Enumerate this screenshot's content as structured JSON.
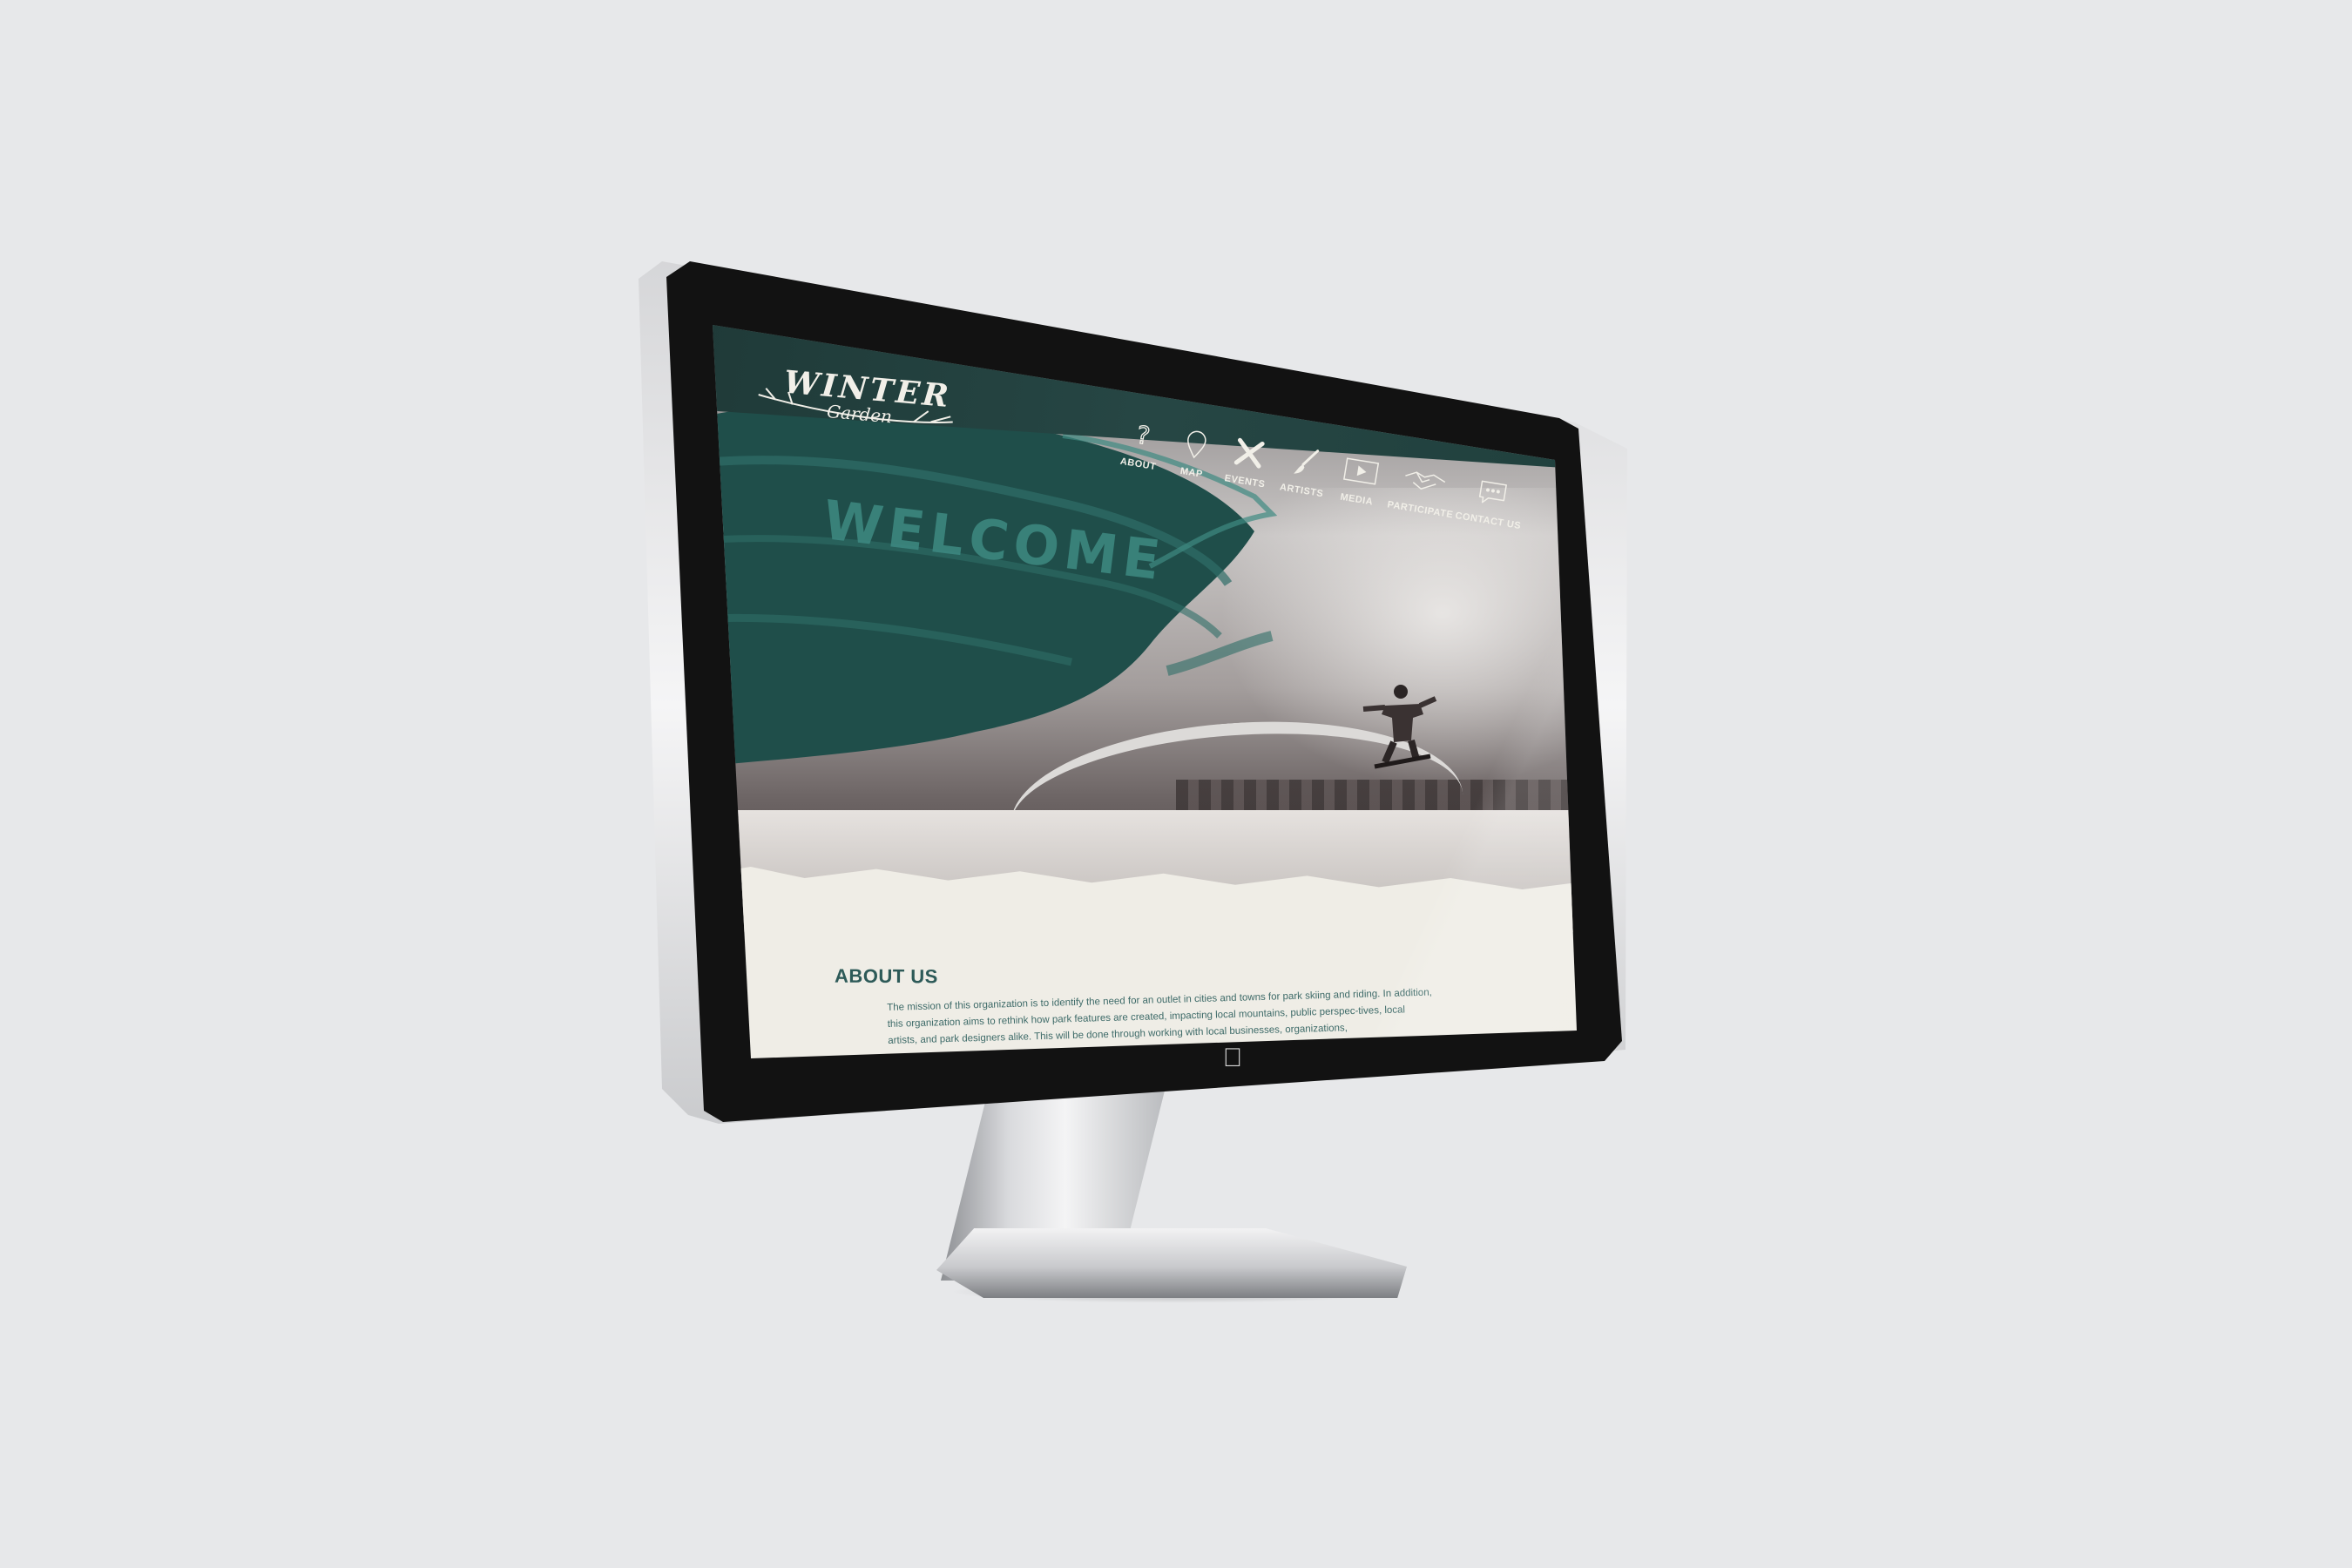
{
  "logo": {
    "line1": "WINTER",
    "line2": "Garden"
  },
  "nav": {
    "items": [
      {
        "label": "ABOUT",
        "icon": "question-icon"
      },
      {
        "label": "MAP",
        "icon": "map-pin-icon"
      },
      {
        "label": "EVENTS",
        "icon": "crossed-skis-icon"
      },
      {
        "label": "ARTISTS",
        "icon": "paintbrush-icon"
      },
      {
        "label": "MEDIA",
        "icon": "play-icon"
      },
      {
        "label": "PARTICIPATE",
        "icon": "handshake-icon"
      },
      {
        "label": "CONTACT US",
        "icon": "speech-bubble-icon"
      }
    ]
  },
  "hero": {
    "headline": "WELCOME"
  },
  "about": {
    "title": "ABOUT US",
    "body": "The mission of this organization is to identify the need for an outlet in cities and towns for park skiing and riding. In addition, this organization aims to rethink how park features are created, impacting local mountains, public perspec-tives, local artists, and park designers alike. This will be done through working with local businesses, organizations,"
  },
  "colors": {
    "header": "#264644",
    "accent": "#3e8a82",
    "paper": "#efede6",
    "text": "#2d5a58"
  }
}
